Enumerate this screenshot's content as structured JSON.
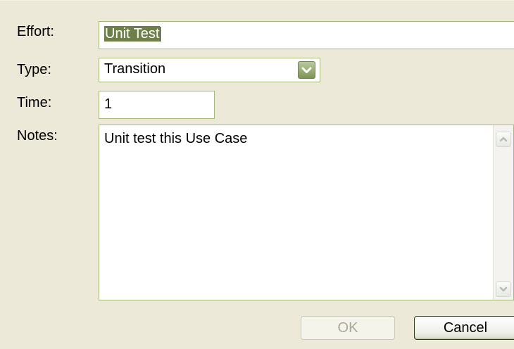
{
  "form": {
    "effort": {
      "label": "Effort:",
      "value": "Unit Test"
    },
    "type": {
      "label": "Type:",
      "value": "Transition"
    },
    "time": {
      "label": "Time:",
      "value": "1"
    },
    "notes": {
      "label": "Notes:",
      "value": "Unit test this Use Case"
    }
  },
  "buttons": {
    "ok_label": "OK",
    "cancel_label": "Cancel"
  },
  "icons": {
    "dropdown": "chevron-down-icon",
    "scroll_up": "arrow-up-icon",
    "scroll_down": "arrow-down-icon"
  },
  "colors": {
    "dialog_bg": "#ece9d8",
    "field_border": "#a5b97d",
    "selection": "#6f7f4a",
    "disabled_text": "#aca899"
  }
}
